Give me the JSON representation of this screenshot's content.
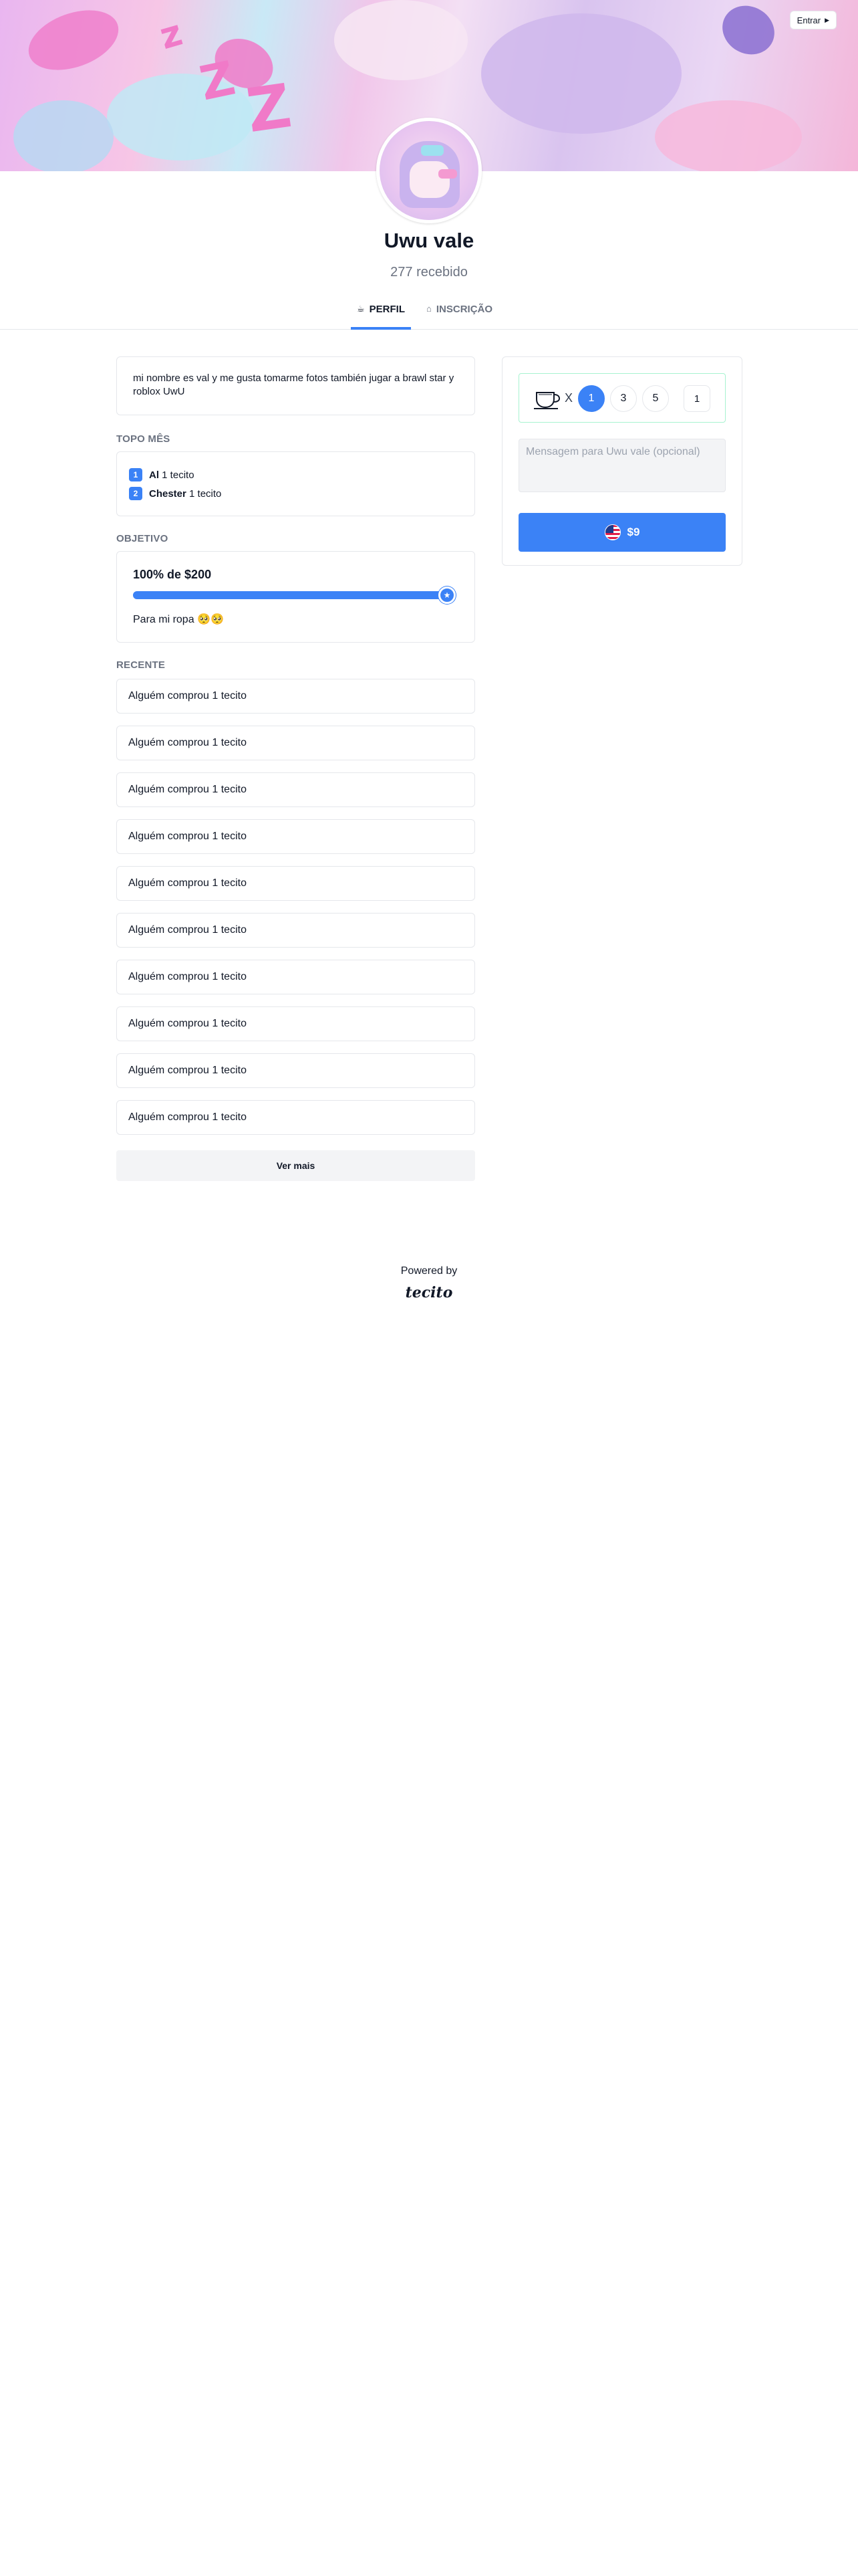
{
  "header": {
    "login_label": "Entrar"
  },
  "profile": {
    "name": "Uwu vale",
    "received": "277 recebido"
  },
  "tabs": [
    {
      "label": "PERFIL",
      "icon": "coffee-icon",
      "active": true
    },
    {
      "label": "INSCRIÇÃO",
      "icon": "lock-icon",
      "active": false
    }
  ],
  "about": "mi nombre es val y me gusta tomarme fotos también jugar a brawl star y roblox UwU",
  "top_month": {
    "label": "TOPO MÊS",
    "entries": [
      {
        "rank": "1",
        "name": "Al",
        "amount": "1 tecito"
      },
      {
        "rank": "2",
        "name": "Chester",
        "amount": "1 tecito"
      }
    ]
  },
  "goal": {
    "label": "OBJETIVO",
    "title": "100% de $200",
    "progress": 1.0,
    "description": "Para mi ropa 🥺🥺"
  },
  "recent": {
    "label": "RECENTE",
    "items": [
      "Alguém comprou 1 tecito",
      "Alguém comprou 1 tecito",
      "Alguém comprou 1 tecito",
      "Alguém comprou 1 tecito",
      "Alguém comprou 1 tecito",
      "Alguém comprou 1 tecito",
      "Alguém comprou 1 tecito",
      "Alguém comprou 1 tecito",
      "Alguém comprou 1 tecito",
      "Alguém comprou 1 tecito"
    ],
    "see_more_label": "Ver mais"
  },
  "support": {
    "times": "X",
    "quantities": [
      "1",
      "3",
      "5"
    ],
    "selected_quantity": "1",
    "custom_value": "1",
    "message_placeholder": "Mensagem para Uwu vale (opcional)",
    "pay_label": "$9"
  },
  "footer": {
    "powered_by": "Powered by",
    "brand": "tecito"
  },
  "colors": {
    "accent": "#3b82f6",
    "muted_text": "#6b7280",
    "border": "#e5e7eb"
  }
}
